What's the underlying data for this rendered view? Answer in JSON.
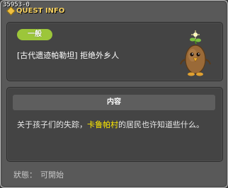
{
  "window": {
    "quest_id": "35953-0",
    "title": "QUEST INFO"
  },
  "quest": {
    "category": "一般",
    "title": "[古代遗迹帕勒坦] 拒绝外乡人",
    "npc_icon": "potato-npc-icon"
  },
  "content": {
    "header": "内容",
    "text_before": "关于孩子们的失踪，",
    "highlight": "卡鲁帕村",
    "text_after": "的居民也许知道些什么。",
    "highlight_color": "#ffea00"
  },
  "status": {
    "label": "狀態：",
    "value": "可開始"
  },
  "colors": {
    "category_pill": "#9cc63a",
    "title_text": "#f5d060"
  }
}
